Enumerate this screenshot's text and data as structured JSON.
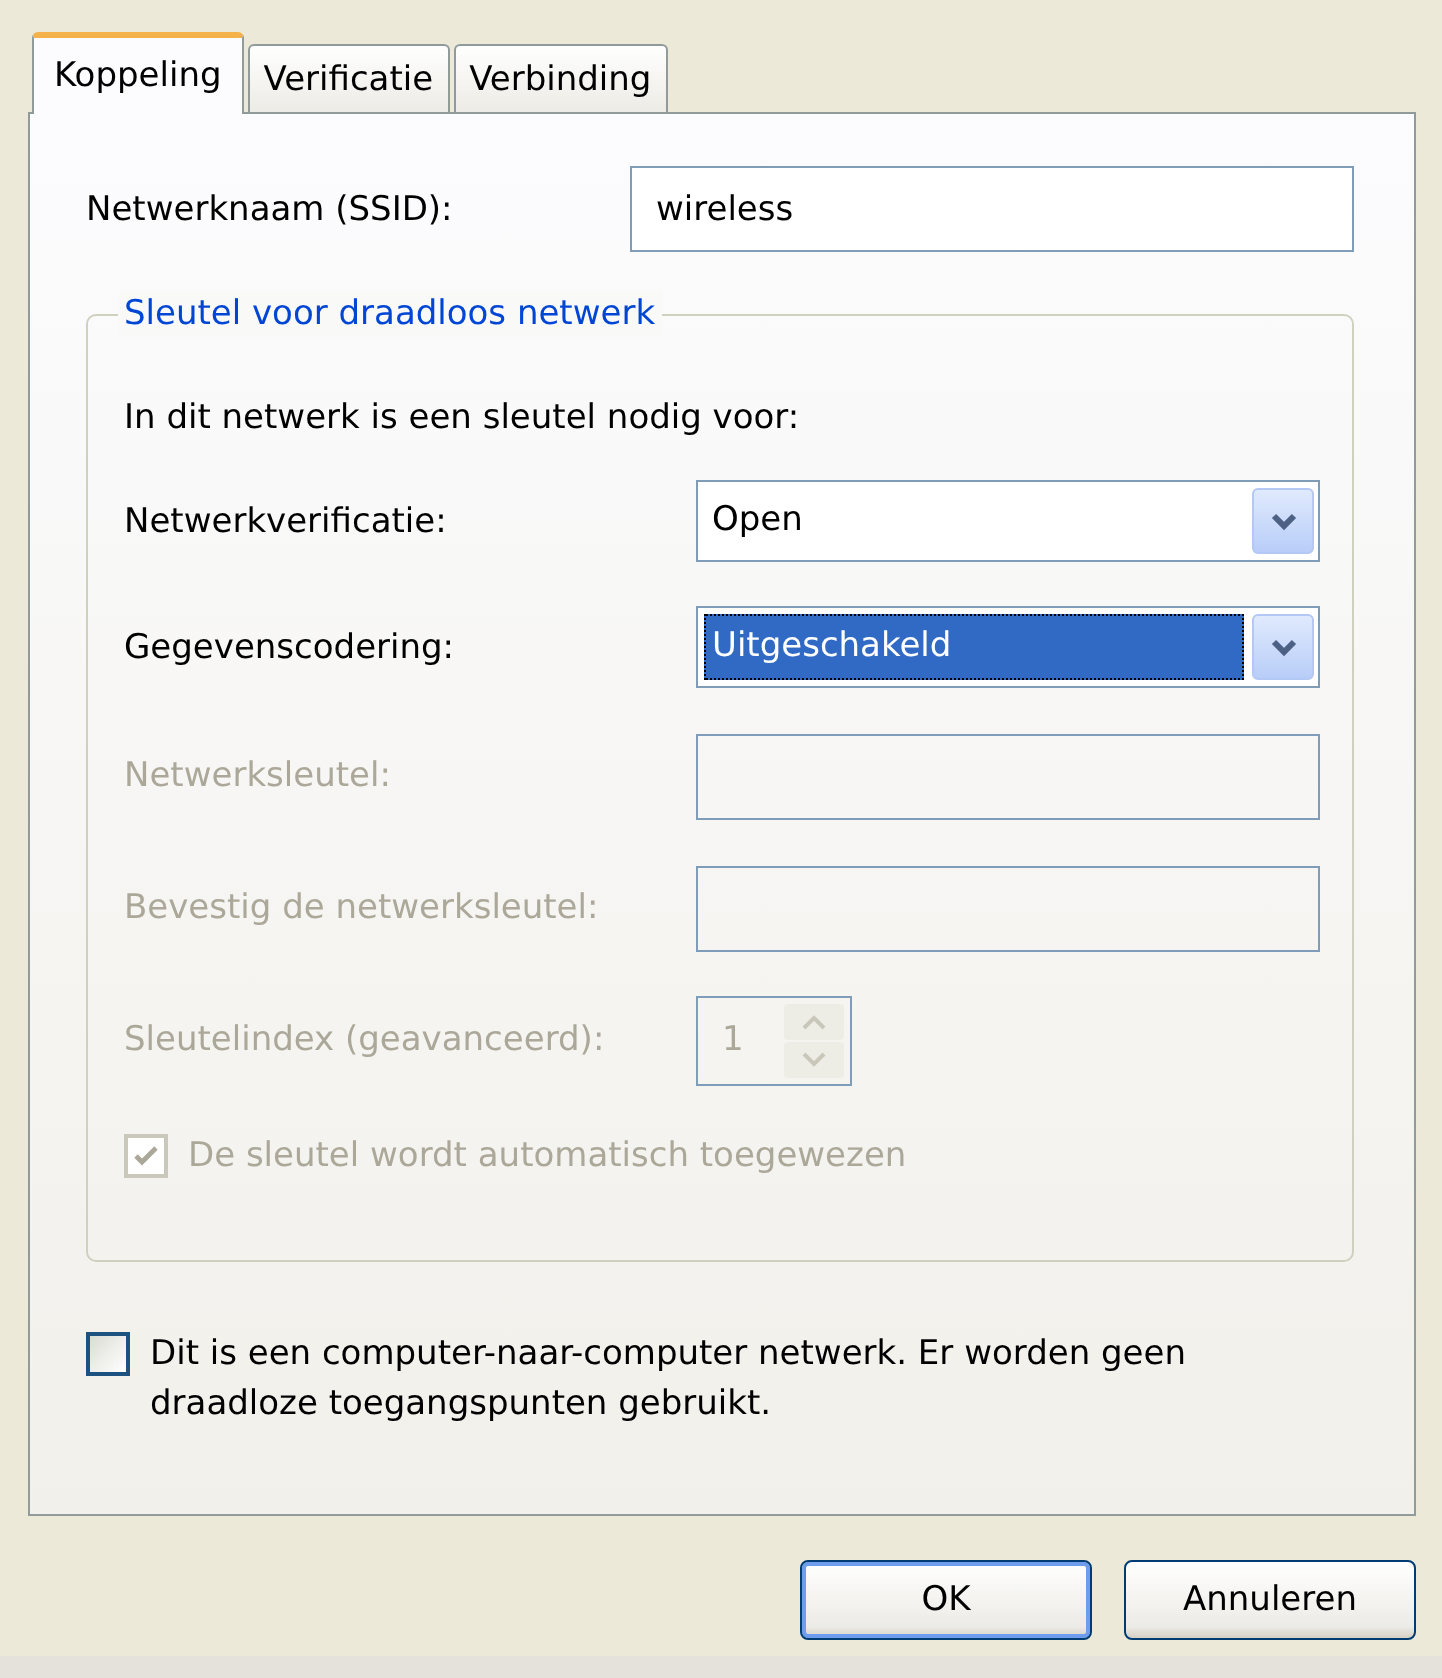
{
  "tabs": [
    {
      "label": "Koppeling",
      "selected": true
    },
    {
      "label": "Verificatie",
      "selected": false
    },
    {
      "label": "Verbinding",
      "selected": false
    }
  ],
  "ssid": {
    "label": "Netwerknaam (SSID):",
    "value": "wireless"
  },
  "group": {
    "title": "Sleutel voor draadloos netwerk",
    "intro": "In dit netwerk is een sleutel nodig voor:",
    "rows": [
      {
        "kind": "select",
        "label": "Netwerkverificatie:",
        "value": "Open",
        "disabled": false,
        "focused": false
      },
      {
        "kind": "select",
        "label": "Gegevenscodering:",
        "value": "Uitgeschakeld",
        "disabled": false,
        "focused": true
      },
      {
        "kind": "text",
        "label": "Netwerksleutel:",
        "disabled": true
      },
      {
        "kind": "text",
        "label": "Bevestig de netwerksleutel:",
        "disabled": true
      },
      {
        "kind": "spinner",
        "label": "Sleutelindex (geavanceerd):",
        "value": "1",
        "disabled": true
      }
    ],
    "auto_key": {
      "label": "De sleutel wordt automatisch toegewezen",
      "checked": true,
      "disabled": true
    }
  },
  "adhoc": {
    "label": "Dit is een computer-naar-computer netwerk. Er worden geen draadloze toegangspunten gebruikt.",
    "checked": false,
    "disabled": false
  },
  "buttons": [
    {
      "label": "OK",
      "default": true
    },
    {
      "label": "Annuleren",
      "default": false
    }
  ]
}
